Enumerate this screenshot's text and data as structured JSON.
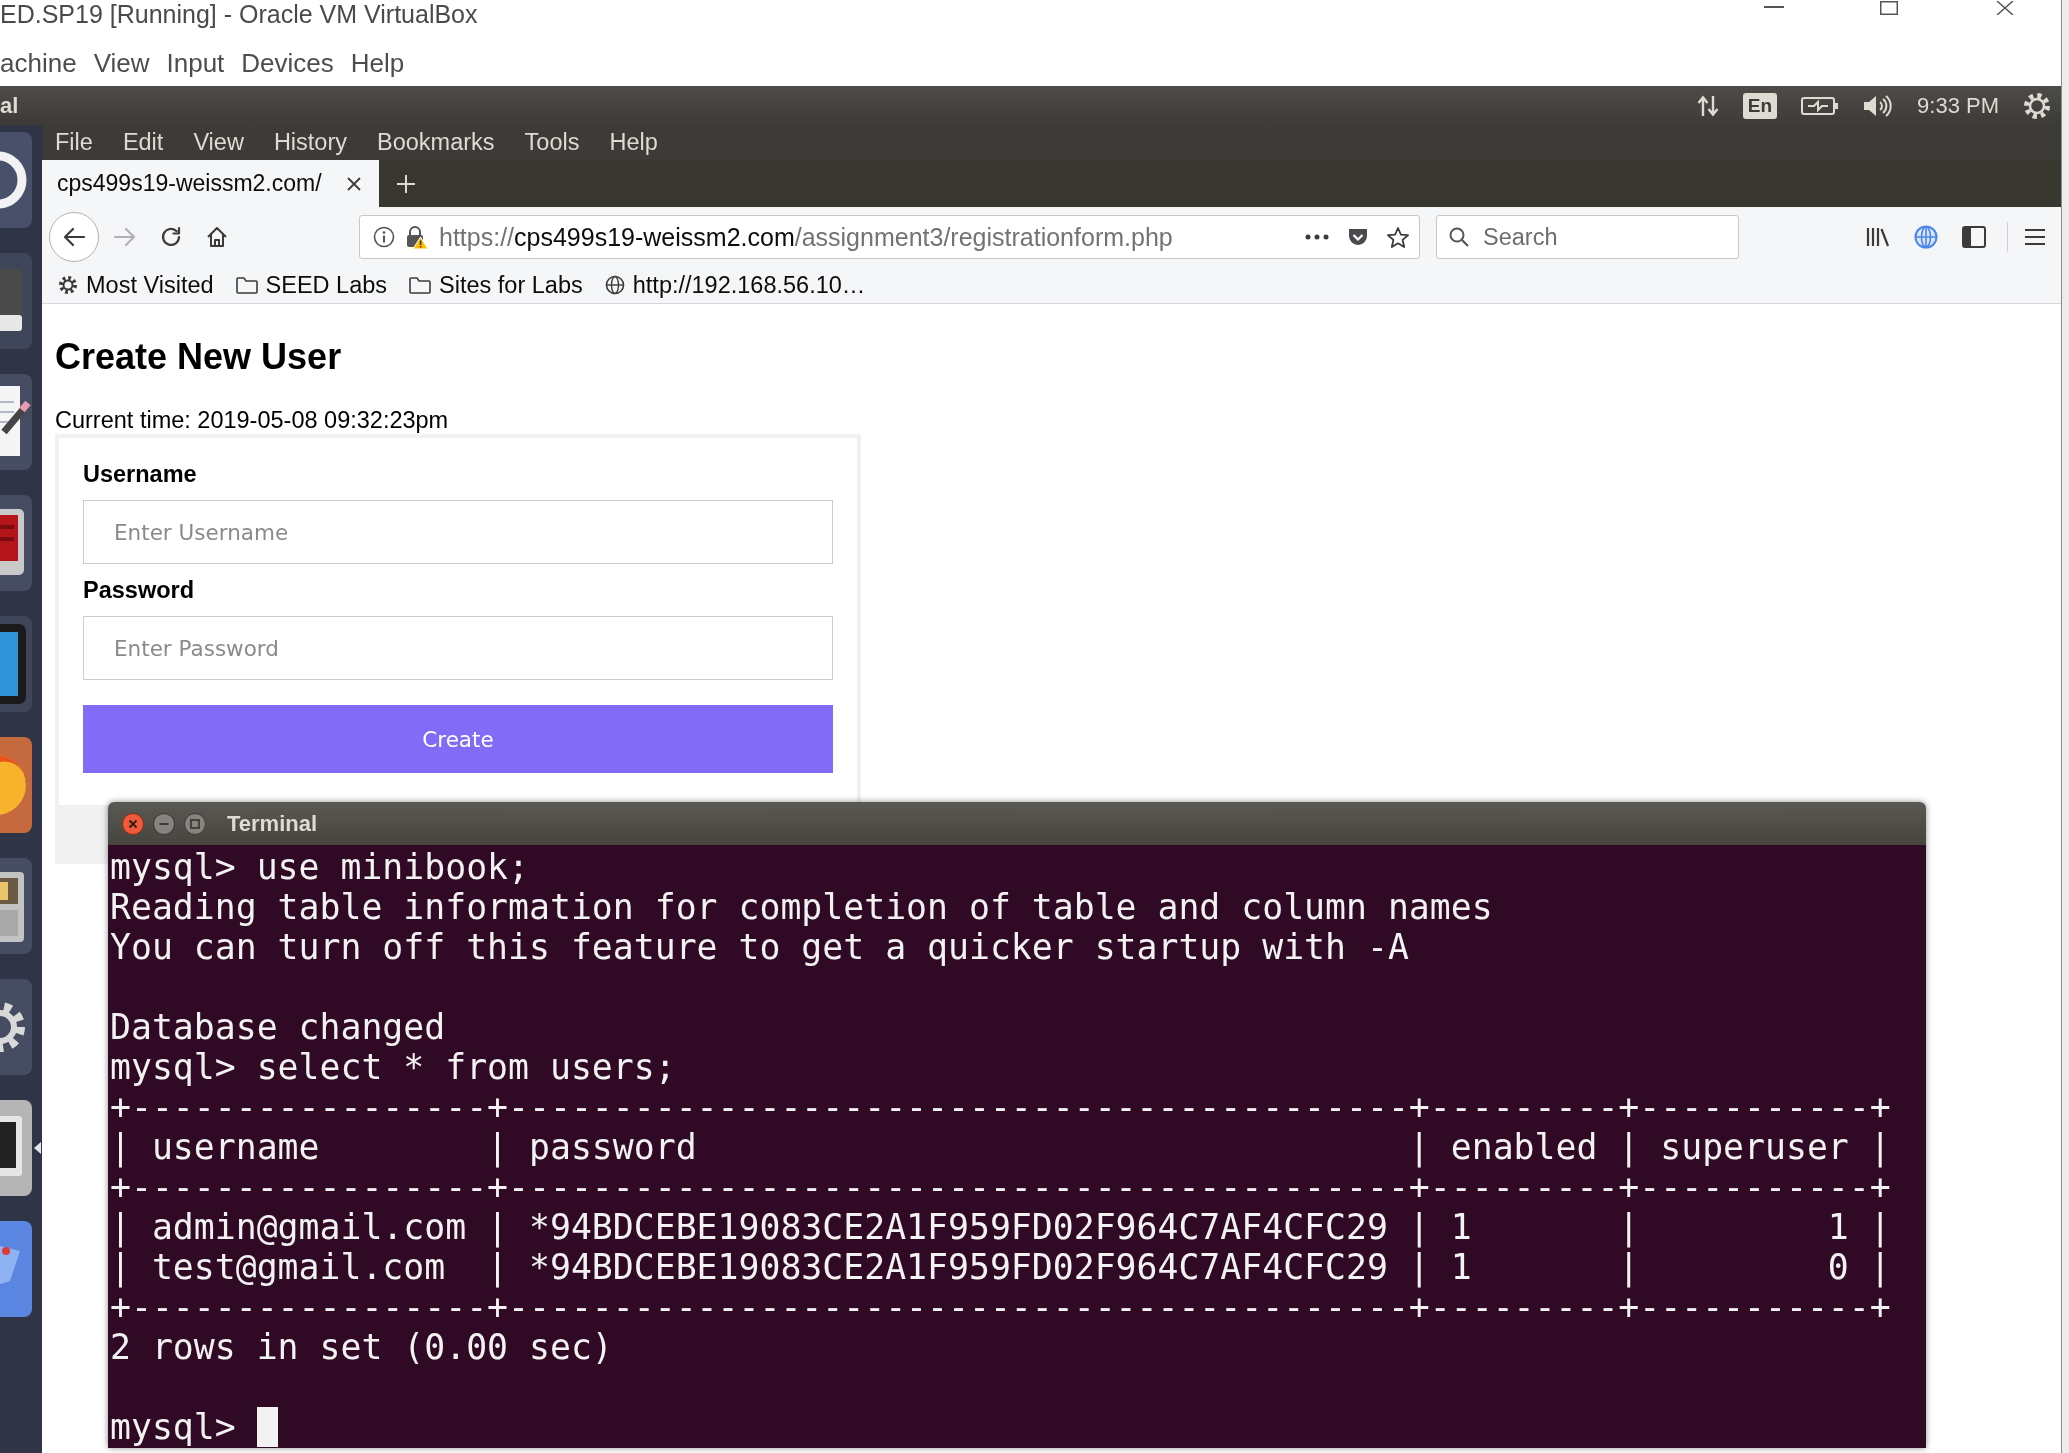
{
  "vbox_window": {
    "title": "ED.SP19 [Running] - Oracle VM VirtualBox",
    "menu": [
      "achine",
      "View",
      "Input",
      "Devices",
      "Help"
    ]
  },
  "top_panel": {
    "app_title": "al",
    "keyboard_layout": "En",
    "clock": "9:33 PM"
  },
  "launcher": {
    "items": [
      {
        "kind": "dash",
        "active": false
      },
      {
        "kind": "drive",
        "active": false
      },
      {
        "kind": "editor",
        "active": false
      },
      {
        "kind": "slides",
        "active": false
      },
      {
        "kind": "window",
        "active": false
      },
      {
        "kind": "browser",
        "active": false
      },
      {
        "kind": "files",
        "active": false
      },
      {
        "kind": "settings",
        "active": false
      },
      {
        "kind": "monitor",
        "active": true
      },
      {
        "kind": "map",
        "active": false
      }
    ]
  },
  "browser": {
    "menu": [
      "File",
      "Edit",
      "View",
      "History",
      "Bookmarks",
      "Tools",
      "Help"
    ],
    "tabs": [
      {
        "title": "cps499s19-weissm2.com/",
        "selected": true
      }
    ],
    "nav_buttons": [
      {
        "kind": "back",
        "disabled": false
      },
      {
        "kind": "forward",
        "disabled": true
      },
      {
        "kind": "reload",
        "disabled": false
      },
      {
        "kind": "home",
        "disabled": false
      }
    ],
    "address_bar": {
      "url_parts": [
        {
          "kind": "scheme",
          "text": "https://"
        },
        {
          "kind": "host",
          "text": "cps499s19-weissm2.com"
        },
        {
          "kind": "path",
          "text": "/assignment3/registrationform.php"
        }
      ]
    },
    "search": {
      "placeholder": "Search"
    },
    "bookmarks": [
      {
        "kind": "smart",
        "label": "Most Visited"
      },
      {
        "kind": "folder",
        "label": "SEED Labs"
      },
      {
        "kind": "folder",
        "label": "Sites for Labs"
      },
      {
        "kind": "page",
        "label": "http://192.168.56.10…"
      }
    ]
  },
  "page": {
    "heading": "Create New User",
    "current_time": "Current time: 2019-05-08 09:32:23pm",
    "form": {
      "fields": [
        {
          "label": "Username",
          "placeholder": "Enter Username"
        },
        {
          "label": "Password",
          "placeholder": "Enter Password"
        }
      ],
      "submit": "Create"
    }
  },
  "terminal": {
    "title": "Terminal",
    "lines": [
      {
        "kind": "text",
        "text": "mysql> use minibook;"
      },
      {
        "kind": "text",
        "text": "Reading table information for completion of table and column names"
      },
      {
        "kind": "text",
        "text": "You can turn off this feature to get a quicker startup with -A"
      },
      {
        "kind": "blank"
      },
      {
        "kind": "text",
        "text": "Database changed"
      },
      {
        "kind": "text",
        "text": "mysql> select * from users;"
      },
      {
        "kind": "text",
        "text": "+-----------------+-------------------------------------------+---------+-----------+"
      },
      {
        "kind": "text",
        "text": "| username        | password                                  | enabled | superuser |"
      },
      {
        "kind": "text",
        "text": "+-----------------+-------------------------------------------+---------+-----------+"
      },
      {
        "kind": "text",
        "text": "| admin@gmail.com | *94BDCEBE19083CE2A1F959FD02F964C7AF4CFC29 | 1       |         1 |"
      },
      {
        "kind": "text",
        "text": "| test@gmail.com  | *94BDCEBE19083CE2A1F959FD02F964C7AF4CFC29 | 1       |         0 |"
      },
      {
        "kind": "text",
        "text": "+-----------------+-------------------------------------------+---------+-----------+"
      },
      {
        "kind": "text",
        "text": "2 rows in set (0.00 sec)"
      },
      {
        "kind": "blank"
      },
      {
        "kind": "text",
        "text": "mysql>"
      }
    ],
    "cursor": true
  }
}
